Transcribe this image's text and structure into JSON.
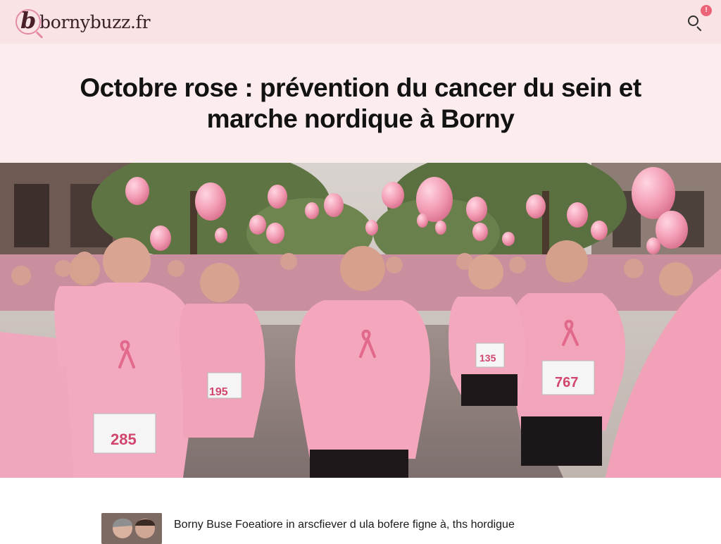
{
  "site": {
    "name": "bornybuzz.fr",
    "logo_letter": "b",
    "notification_count": "!",
    "icons": {
      "search": "search-icon",
      "notification": "notification-badge-icon"
    }
  },
  "article": {
    "title": "Octobre rose : prévention du cancer du sein et marche nordique à Borny",
    "lead": "Borny Buse Foeatiore in arscfiever d ula bofere figne à, ths hordigue"
  },
  "hero_image": {
    "bib_numbers": [
      "285",
      "195",
      "135",
      "767"
    ]
  },
  "colors": {
    "topbar": "#f9e3e5",
    "title_band": "#fdeced",
    "accent_pink": "#e58aa6",
    "badge": "#ec6377"
  }
}
